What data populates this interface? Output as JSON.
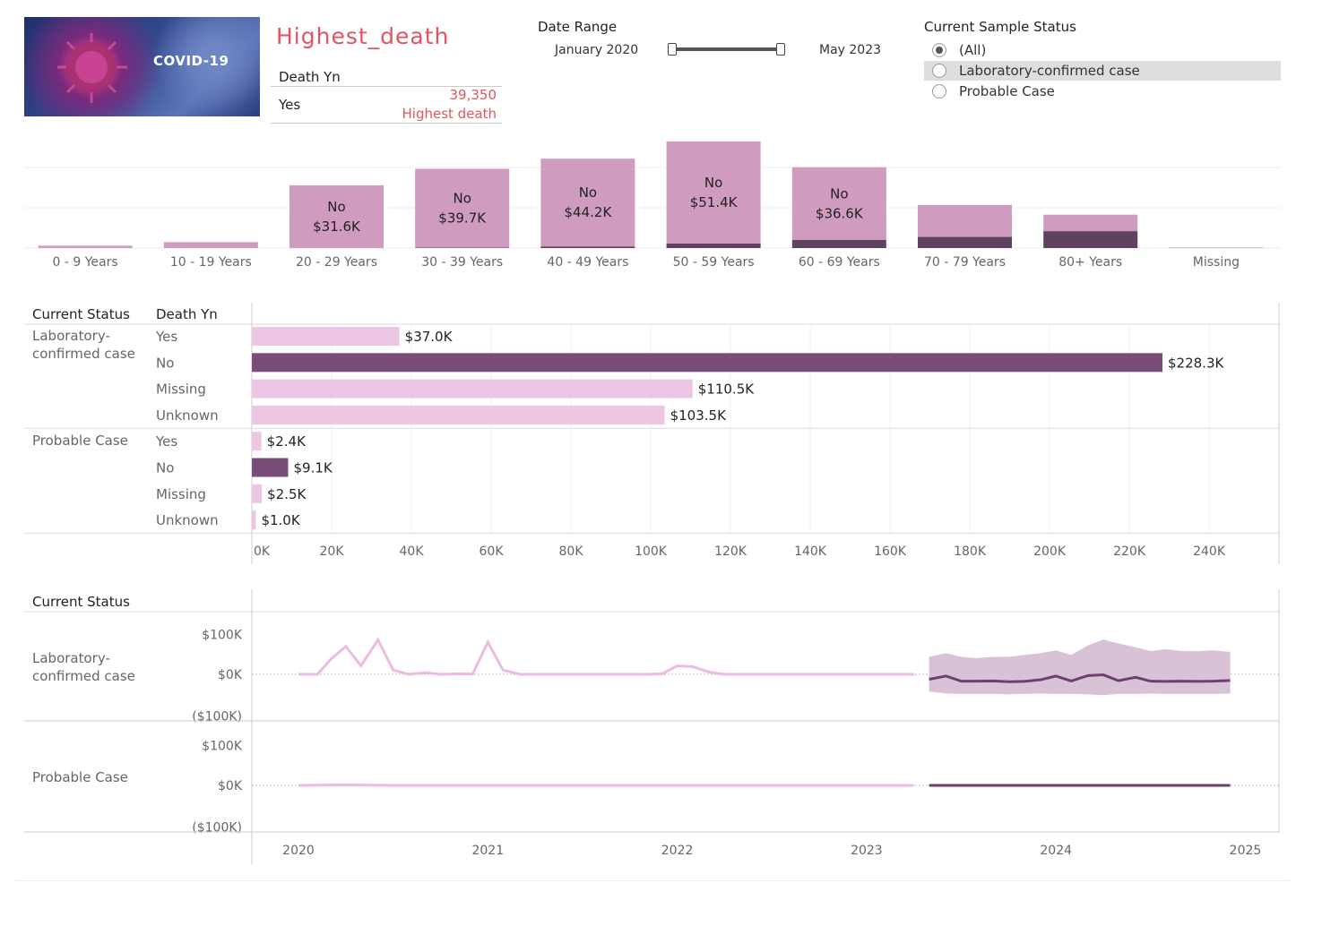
{
  "header": {
    "image_label": "COVID-19",
    "title": "Highest_death",
    "kpi_column": "Death Yn",
    "kpi_row": "Yes",
    "kpi_value": "39,350",
    "kpi_caption": "Highest death"
  },
  "date_range": {
    "title": "Date Range",
    "start": "January 2020",
    "end": "May 2023"
  },
  "sample_status": {
    "title": "Current Sample Status",
    "options": [
      {
        "label": "(All)",
        "selected": true
      },
      {
        "label": "Laboratory-confirmed case",
        "selected": false
      },
      {
        "label": "Probable Case",
        "selected": false
      }
    ]
  },
  "colors": {
    "light_pink": "#cf9bbf",
    "dark_purple": "#5e4360",
    "bar_light": "#ecc6e2",
    "bar_dark": "#7a4c78",
    "accent_red": "#e05560"
  },
  "chart_data": [
    {
      "type": "bar",
      "stacked": true,
      "categories": [
        "0 - 9 Years",
        "10 - 19 Years",
        "20 - 29 Years",
        "30 - 39 Years",
        "40 - 49 Years",
        "50 - 59 Years",
        "60 - 69 Years",
        "70 - 79 Years",
        "80+ Years",
        "Missing"
      ],
      "series": [
        {
          "name": "Yes",
          "values": [
            0.0,
            0.0,
            0.0,
            0.2,
            0.8,
            2.3,
            4.1,
            5.6,
            8.5,
            0.0
          ]
        },
        {
          "name": "No",
          "values": [
            1.2,
            3.0,
            31.6,
            39.7,
            44.2,
            51.4,
            36.6,
            16.1,
            8.3,
            0.3
          ]
        }
      ],
      "data_labels": [
        "",
        "",
        "No\n$31.6K",
        "No\n$39.7K",
        "No\n$44.2K",
        "No\n$51.4K",
        "No\n$36.6K",
        "",
        "",
        ""
      ],
      "ylim": [
        0,
        55
      ],
      "grid": true
    },
    {
      "type": "bar",
      "orientation": "horizontal",
      "headers": [
        "Current Status",
        "Death Yn"
      ],
      "groups": [
        {
          "status": "Laboratory-\nconfirmed case",
          "rows": [
            {
              "death": "Yes",
              "value": 37.0,
              "label": "$37.0K",
              "dark": false
            },
            {
              "death": "No",
              "value": 228.3,
              "label": "$228.3K",
              "dark": true
            },
            {
              "death": "Missing",
              "value": 110.5,
              "label": "$110.5K",
              "dark": false
            },
            {
              "death": "Unknown",
              "value": 103.5,
              "label": "$103.5K",
              "dark": false
            }
          ]
        },
        {
          "status": "Probable Case",
          "rows": [
            {
              "death": "Yes",
              "value": 2.4,
              "label": "$2.4K",
              "dark": false
            },
            {
              "death": "No",
              "value": 9.1,
              "label": "$9.1K",
              "dark": true
            },
            {
              "death": "Missing",
              "value": 2.5,
              "label": "$2.5K",
              "dark": false
            },
            {
              "death": "Unknown",
              "value": 1.0,
              "label": "$1.0K",
              "dark": false
            }
          ]
        }
      ],
      "x_ticks": [
        "0K",
        "20K",
        "40K",
        "60K",
        "80K",
        "100K",
        "120K",
        "140K",
        "160K",
        "180K",
        "200K",
        "220K",
        "240K"
      ],
      "xlim": [
        0,
        250
      ]
    },
    {
      "type": "line",
      "header": "Current Status",
      "x_ticks": [
        "2020",
        "2021",
        "2022",
        "2023",
        "2024",
        "2025"
      ],
      "y_ticks": [
        "$100K",
        "$0K",
        "($100K)"
      ],
      "ylim": [
        -100,
        100
      ],
      "panels": [
        {
          "status": "Laboratory-\nconfirmed case",
          "actual": {
            "x": [
              2020.0,
              2020.1,
              2020.17,
              2020.25,
              2020.33,
              2020.42,
              2020.5,
              2020.58,
              2020.67,
              2020.75,
              2020.83,
              2020.92,
              2021.0,
              2021.08,
              2021.17,
              2021.25,
              2021.5,
              2021.75,
              2021.83,
              2021.92,
              2022.0,
              2022.08,
              2022.17,
              2022.25,
              2022.5,
              2022.75,
              2023.0,
              2023.25
            ],
            "y": [
              0,
              0,
              35,
              65,
              20,
              80,
              10,
              0,
              4,
              0,
              1,
              1,
              75,
              10,
              0,
              0,
              0,
              0,
              0,
              1,
              20,
              18,
              5,
              0,
              0,
              0,
              0,
              0
            ]
          },
          "forecast": {
            "x": [
              2023.33,
              2023.42,
              2023.5,
              2023.58,
              2023.67,
              2023.75,
              2023.83,
              2023.92,
              2024.0,
              2024.08,
              2024.17,
              2024.25,
              2024.33,
              2024.42,
              2024.5,
              2024.58,
              2024.67,
              2024.75,
              2024.83,
              2024.92
            ],
            "y": [
              -20,
              -7,
              -28,
              -28,
              -27,
              -30,
              -29,
              -22,
              -7,
              -27,
              -5,
              -2,
              -26,
              -12,
              -28,
              -29,
              -28,
              -29,
              -28,
              -25
            ],
            "upper": [
              45,
              55,
              45,
              42,
              45,
              45,
              50,
              55,
              62,
              50,
              75,
              90,
              80,
              70,
              60,
              65,
              60,
              60,
              62,
              58
            ],
            "lower": [
              -70,
              -78,
              -80,
              -80,
              -80,
              -82,
              -80,
              -78,
              -80,
              -80,
              -82,
              -85,
              -80,
              -80,
              -78,
              -80,
              -80,
              -80,
              -80,
              -78
            ]
          }
        },
        {
          "status": "Probable Case",
          "actual": {
            "x": [
              2020.0,
              2020.25,
              2020.5,
              2020.75,
              2021.0,
              2021.25,
              2021.5,
              2021.75,
              2022.0,
              2022.25,
              2022.5,
              2022.75,
              2023.0,
              2023.25
            ],
            "y": [
              0,
              1,
              0,
              0,
              0,
              0,
              0,
              0,
              0,
              0,
              0,
              0,
              0,
              0
            ]
          },
          "forecast": {
            "x": [
              2023.33,
              2023.58,
              2023.83,
              2024.08,
              2024.33,
              2024.58,
              2024.83,
              2024.92
            ],
            "y": [
              0,
              0,
              0,
              0,
              0,
              0,
              0,
              0
            ],
            "upper": [],
            "lower": []
          }
        }
      ]
    }
  ]
}
